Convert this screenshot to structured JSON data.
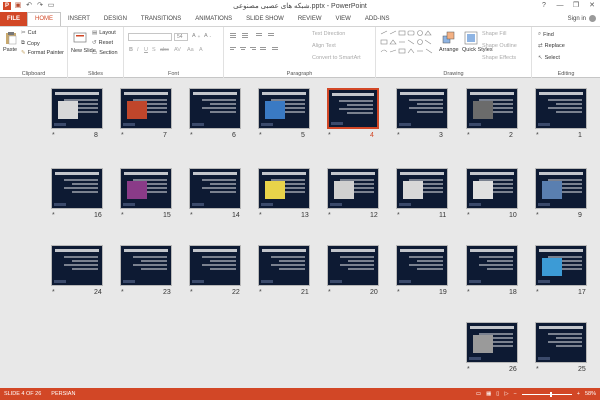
{
  "window": {
    "title": "شبکه های عصبی مصنوعی.pptx - PowerPoint",
    "controls": [
      "?",
      "—",
      "❐",
      "✕"
    ]
  },
  "qat": [
    "save-icon",
    "undo-icon",
    "redo-icon",
    "present-icon"
  ],
  "tabs": [
    {
      "label": "FILE"
    },
    {
      "label": "HOME"
    },
    {
      "label": "INSERT"
    },
    {
      "label": "DESIGN"
    },
    {
      "label": "TRANSITIONS"
    },
    {
      "label": "ANIMATIONS"
    },
    {
      "label": "SLIDE SHOW"
    },
    {
      "label": "REVIEW"
    },
    {
      "label": "VIEW"
    },
    {
      "label": "ADD-INS"
    }
  ],
  "user": {
    "signin": "Sign in"
  },
  "ribbon": {
    "clipboard": {
      "label": "Clipboard",
      "paste": "Paste",
      "cut": "Cut",
      "copy": "Copy",
      "format_painter": "Format Painter"
    },
    "slides": {
      "label": "Slides",
      "new_slide": "New Slide",
      "layout": "Layout",
      "reset": "Reset",
      "section": "Section"
    },
    "font": {
      "label": "Font",
      "size": "54",
      "buttons": [
        "B",
        "I",
        "U",
        "S",
        "abc",
        "AV",
        "Aa",
        "A"
      ]
    },
    "paragraph": {
      "label": "Paragraph",
      "text_direction": "Text Direction",
      "align_text": "Align Text",
      "smartart": "Convert to SmartArt"
    },
    "drawing": {
      "label": "Drawing",
      "arrange": "Arrange",
      "quick_styles": "Quick Styles",
      "shape_fill": "Shape Fill",
      "shape_outline": "Shape Outline",
      "shape_effects": "Shape Effects"
    },
    "editing": {
      "label": "Editing",
      "find": "Find",
      "replace": "Replace",
      "select": "Select"
    }
  },
  "slides": [
    {
      "num": "1",
      "star": "*",
      "title": "شبکه های عصبی مصنوعی"
    },
    {
      "num": "2",
      "star": "*",
      "title": "شبکه های عصبی مصنوعی چیست؟"
    },
    {
      "num": "3",
      "star": "*"
    },
    {
      "num": "4",
      "star": "*",
      "selected": true
    },
    {
      "num": "5",
      "star": "*"
    },
    {
      "num": "6",
      "star": "*"
    },
    {
      "num": "7",
      "star": "*"
    },
    {
      "num": "8",
      "star": "*"
    },
    {
      "num": "9",
      "star": "*"
    },
    {
      "num": "10",
      "star": "*"
    },
    {
      "num": "11",
      "star": "*"
    },
    {
      "num": "12",
      "star": "*"
    },
    {
      "num": "13",
      "star": "*"
    },
    {
      "num": "14",
      "star": "*"
    },
    {
      "num": "15",
      "star": "*"
    },
    {
      "num": "16",
      "star": "*"
    },
    {
      "num": "17",
      "star": "*"
    },
    {
      "num": "18",
      "star": "*"
    },
    {
      "num": "19",
      "star": "*"
    },
    {
      "num": "20",
      "star": "*"
    },
    {
      "num": "21",
      "star": "*"
    },
    {
      "num": "22",
      "star": "*"
    },
    {
      "num": "23",
      "star": "*"
    },
    {
      "num": "24",
      "star": "*"
    },
    {
      "num": "25",
      "star": "*"
    },
    {
      "num": "26",
      "star": "*"
    }
  ],
  "status": {
    "slide": "SLIDE 4 OF 26",
    "language": "PERSIAN",
    "zoom": "58%",
    "zoom_level_percent": 58
  }
}
